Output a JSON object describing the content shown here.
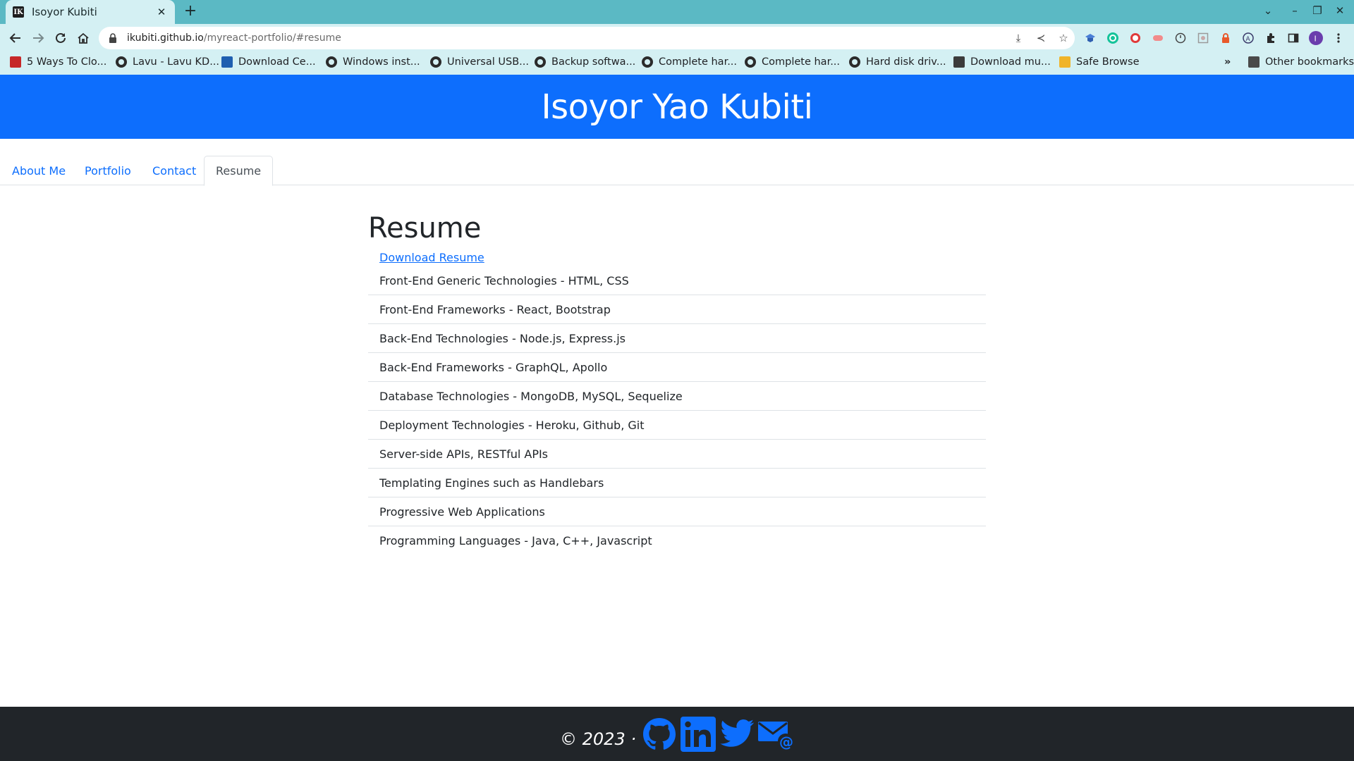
{
  "browser": {
    "tab_title": "Isoyor Kubiti",
    "tab_favicon_letter": "IK",
    "url_host": "ikubiti.github.io",
    "url_path": "/myreact-portfolio/#resume",
    "bookmarks": [
      {
        "label": "5 Ways To Clo...",
        "icon": "pdf-icon"
      },
      {
        "label": "Lavu - Lavu KD...",
        "icon": "globe-icon"
      },
      {
        "label": "Download Ce...",
        "icon": "site-icon"
      },
      {
        "label": "Windows inst...",
        "icon": "globe-icon"
      },
      {
        "label": "Universal USB...",
        "icon": "globe-icon"
      },
      {
        "label": "Backup softwa...",
        "icon": "globe-icon"
      },
      {
        "label": "Complete har...",
        "icon": "globe-icon"
      },
      {
        "label": "Complete har...",
        "icon": "globe-icon"
      },
      {
        "label": "Hard disk driv...",
        "icon": "globe-icon"
      },
      {
        "label": "Download mu...",
        "icon": "site-icon"
      },
      {
        "label": "Safe Browse",
        "icon": "lock-icon"
      }
    ],
    "overflow_label": "»",
    "other_bookmarks": "Other bookmarks"
  },
  "header": {
    "title": "Isoyor Yao Kubiti"
  },
  "nav": {
    "tabs": [
      {
        "label": "About Me"
      },
      {
        "label": "Portfolio"
      },
      {
        "label": "Contact"
      },
      {
        "label": "Resume"
      }
    ],
    "active": "Resume"
  },
  "main": {
    "heading": "Resume",
    "download_label": "Download Resume",
    "skills": [
      "Front-End Generic Technologies - HTML, CSS",
      "Front-End Frameworks - React, Bootstrap",
      "Back-End Technologies - Node.js, Express.js",
      "Back-End Frameworks - GraphQL, Apollo",
      "Database Technologies - MongoDB, MySQL, Sequelize",
      "Deployment Technologies - Heroku, Github, Git",
      "Server-side APIs, RESTful APIs",
      "Templating Engines such as Handlebars",
      "Progressive Web Applications",
      "Programming Languages - Java, C++, Javascript"
    ]
  },
  "footer": {
    "copyright": "© 2023 ·",
    "social": [
      "github-icon",
      "linkedin-icon",
      "twitter-icon",
      "email-icon"
    ]
  },
  "colors": {
    "primary": "#0d6efd",
    "chrome_tabstrip": "#5bb9c4",
    "chrome_toolbar": "#d4f0f3",
    "footer": "#212529"
  }
}
